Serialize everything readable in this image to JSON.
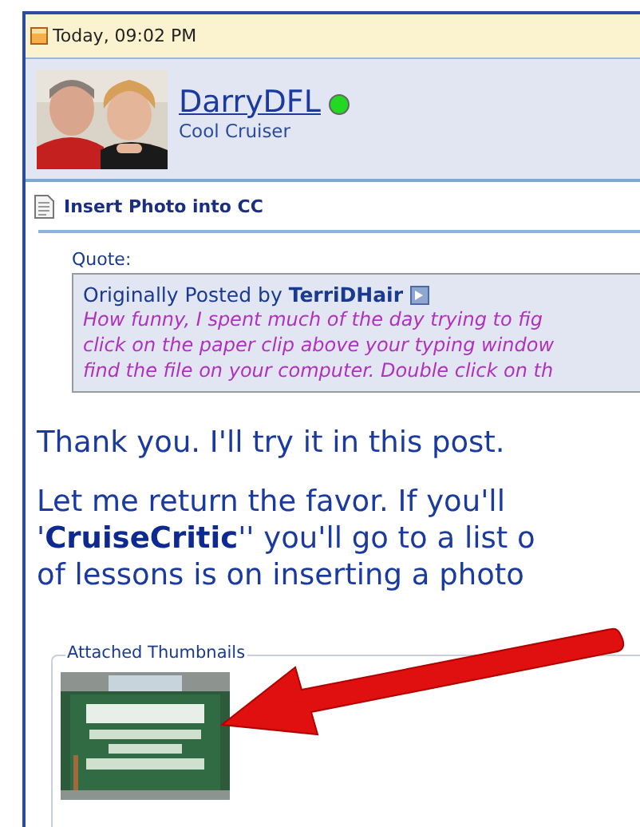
{
  "post": {
    "date": "Today, 09:02 PM",
    "user": {
      "name": "DarryDFL",
      "online": true,
      "rank": "Cool Cruiser"
    },
    "title": "Insert Photo into CC",
    "quote": {
      "label": "Quote:",
      "attribution": "Originally Posted by",
      "author": "TerriDHair",
      "lines": [
        "How funny, I spent much of the day trying to fig",
        "click on the paper clip above your typing window",
        "find the file on your computer. Double click on th"
      ]
    },
    "message": [
      {
        "lines": [
          "Thank you. I'll try it in this post."
        ]
      },
      {
        "lines": [
          "Let me return the favor. If you'll",
          "'**CruiseCritic**'' you'll go to a list o",
          "of lessons is on inserting a photo"
        ]
      }
    ],
    "attachments": {
      "legend": "Attached Thumbnails"
    }
  }
}
